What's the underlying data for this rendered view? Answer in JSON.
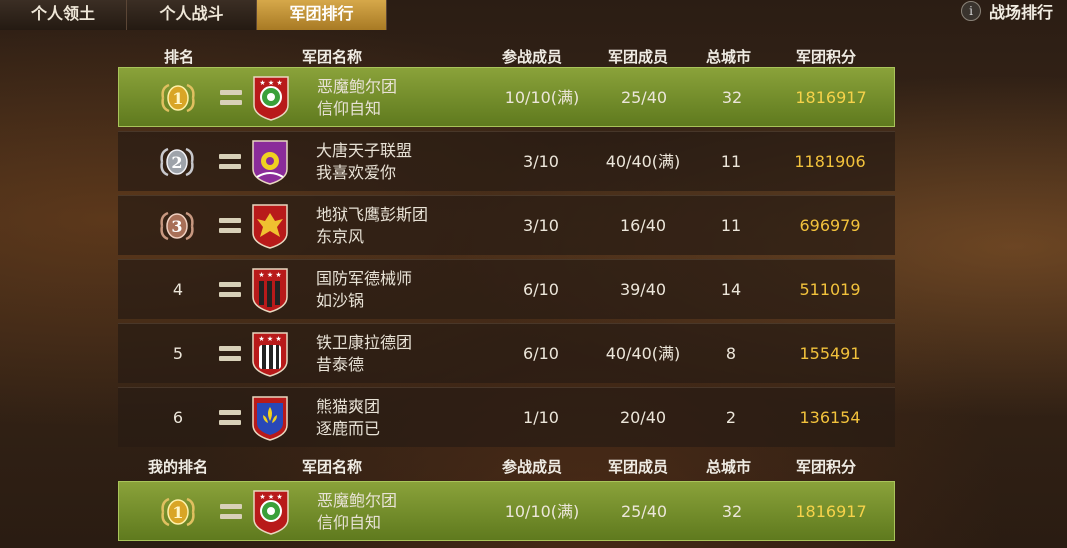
{
  "tabs": [
    {
      "label": "个人领土"
    },
    {
      "label": "个人战斗"
    },
    {
      "label": "军团排行"
    }
  ],
  "top_right": {
    "info": "i",
    "label": "战场排行"
  },
  "header": {
    "rank": "排名",
    "legion_name": "军团名称",
    "participants": "参战成员",
    "members": "军团成员",
    "cities": "总城市",
    "score": "军团积分"
  },
  "rows": [
    {
      "rank": "1",
      "name": "恶魔鲍尔团",
      "leader": "信仰自知",
      "participants": "10/10(满)",
      "members": "25/40",
      "cities": "32",
      "score": "1816917"
    },
    {
      "rank": "2",
      "name": "大唐天子联盟",
      "leader": "我喜欢爱你",
      "participants": "3/10",
      "members": "40/40(满)",
      "cities": "11",
      "score": "1181906"
    },
    {
      "rank": "3",
      "name": "地狱飞鹰彭斯团",
      "leader": "东京风",
      "participants": "3/10",
      "members": "16/40",
      "cities": "11",
      "score": "696979"
    },
    {
      "rank": "4",
      "name": "国防军德械师",
      "leader": "如沙锅",
      "participants": "6/10",
      "members": "39/40",
      "cities": "14",
      "score": "511019"
    },
    {
      "rank": "5",
      "name": "铁卫康拉德团",
      "leader": "昔泰德",
      "participants": "6/10",
      "members": "40/40(满)",
      "cities": "8",
      "score": "155491"
    },
    {
      "rank": "6",
      "name": "熊猫爽团",
      "leader": "逐鹿而已",
      "participants": "1/10",
      "members": "20/40",
      "cities": "2",
      "score": "136154"
    }
  ],
  "my_header": {
    "rank": "我的排名",
    "legion_name": "军团名称",
    "participants": "参战成员",
    "members": "军团成员",
    "cities": "总城市",
    "score": "军团积分"
  },
  "my_row": {
    "rank": "1",
    "name": "恶魔鲍尔团",
    "leader": "信仰自知",
    "participants": "10/10(满)",
    "members": "25/40",
    "cities": "32",
    "score": "1816917"
  },
  "colors": {
    "highlight": "#7a9530",
    "score": "#f2c23c",
    "tab_active": "#c8962f"
  }
}
